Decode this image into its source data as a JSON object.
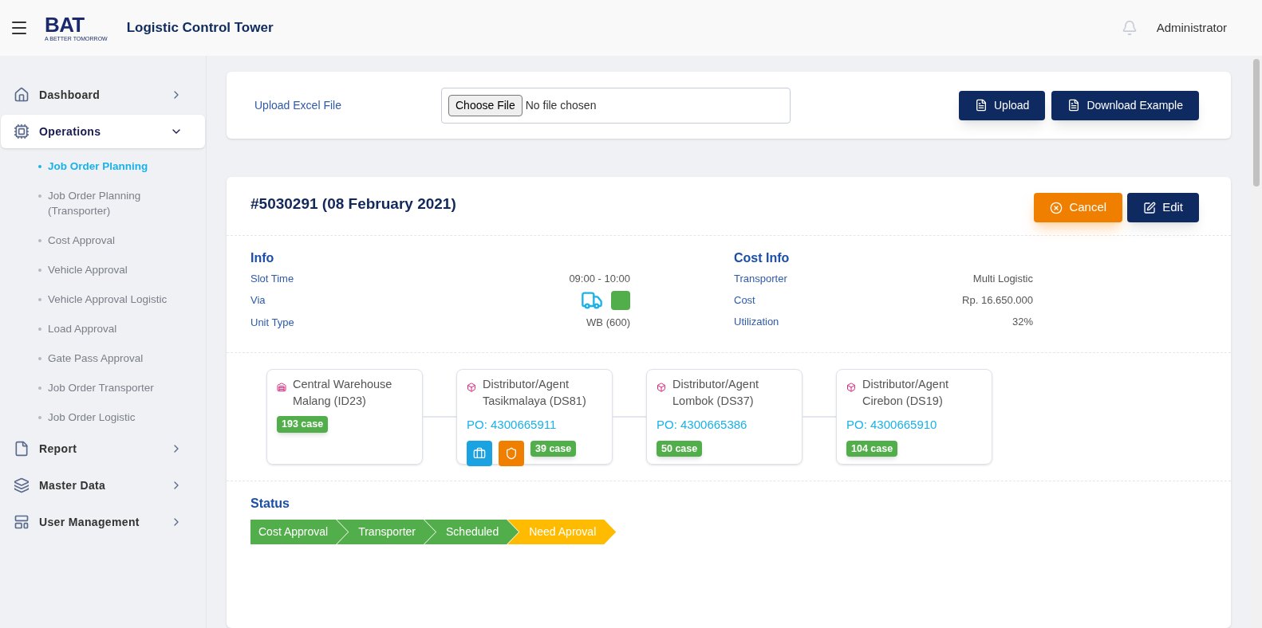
{
  "header": {
    "logo": {
      "text": "BAT",
      "tagline": "A BETTER TOMORROW"
    },
    "title": "Logistic Control Tower",
    "user": "Administrator"
  },
  "sidebar": {
    "items": [
      {
        "label": "Dashboard",
        "expanded": false,
        "selected": false
      },
      {
        "label": "Operations",
        "expanded": true,
        "selected": true,
        "children": [
          {
            "label": "Job Order Planning",
            "selected": true
          },
          {
            "label": "Job Order Planning (Transporter)",
            "selected": false
          },
          {
            "label": "Cost Approval",
            "selected": false
          },
          {
            "label": "Vehicle Approval",
            "selected": false
          },
          {
            "label": "Vehicle Approval Logistic",
            "selected": false
          },
          {
            "label": "Load Approval",
            "selected": false
          },
          {
            "label": "Gate Pass Approval",
            "selected": false
          },
          {
            "label": "Job Order Transporter",
            "selected": false
          },
          {
            "label": "Job Order Logistic",
            "selected": false
          }
        ]
      },
      {
        "label": "Report",
        "expanded": false,
        "selected": false
      },
      {
        "label": "Master Data",
        "expanded": false,
        "selected": false
      },
      {
        "label": "User Management",
        "expanded": false,
        "selected": false
      }
    ]
  },
  "upload": {
    "label": "Upload Excel File",
    "choose_button": "Choose File",
    "file_status": "No file chosen",
    "buttons": [
      "Upload",
      "Download Example"
    ]
  },
  "order": {
    "title": "#5030291 (08 February 2021)",
    "cancel_button": "Cancel",
    "edit_button": "Edit",
    "info": {
      "heading": "Info",
      "rows": [
        {
          "label": "Slot Time",
          "kind": "text",
          "value": "09:00 - 10:00"
        },
        {
          "label": "Via",
          "kind": "via"
        },
        {
          "label": "Unit Type",
          "kind": "text",
          "value": "WB (600)"
        }
      ]
    },
    "cost_info": {
      "heading": "Cost Info",
      "rows": [
        {
          "label": "Transporter",
          "value": "Multi Logistic"
        },
        {
          "label": "Cost",
          "value": "Rp. 16.650.000"
        },
        {
          "label": "Utilization",
          "value": "32%"
        }
      ]
    },
    "route": [
      {
        "kind": "warehouse",
        "name": "Central Warehouse Malang (ID23)",
        "cases": "193 case"
      },
      {
        "kind": "distributor",
        "name": "Distributor/Agent Tasikmalaya (DS81)",
        "po": "PO: 4300665911",
        "tags": [
          {
            "kind": "briefcase"
          },
          {
            "kind": "shield"
          }
        ],
        "cases": "39 case"
      },
      {
        "kind": "distributor",
        "name": "Distributor/Agent Lombok (DS37)",
        "po": "PO: 4300665386",
        "cases": "50 case"
      },
      {
        "kind": "distributor",
        "name": "Distributor/Agent Cirebon (DS19)",
        "po": "PO: 4300665910",
        "cases": "104 case"
      }
    ],
    "status": {
      "heading": "Status",
      "steps": [
        {
          "label": "Cost Approval",
          "color": "#52ae4a"
        },
        {
          "label": "Transporter",
          "color": "#52ae4a"
        },
        {
          "label": "Scheduled",
          "color": "#52ae4a"
        },
        {
          "label": "Need Aproval",
          "color": "#ffbb00"
        }
      ]
    }
  }
}
